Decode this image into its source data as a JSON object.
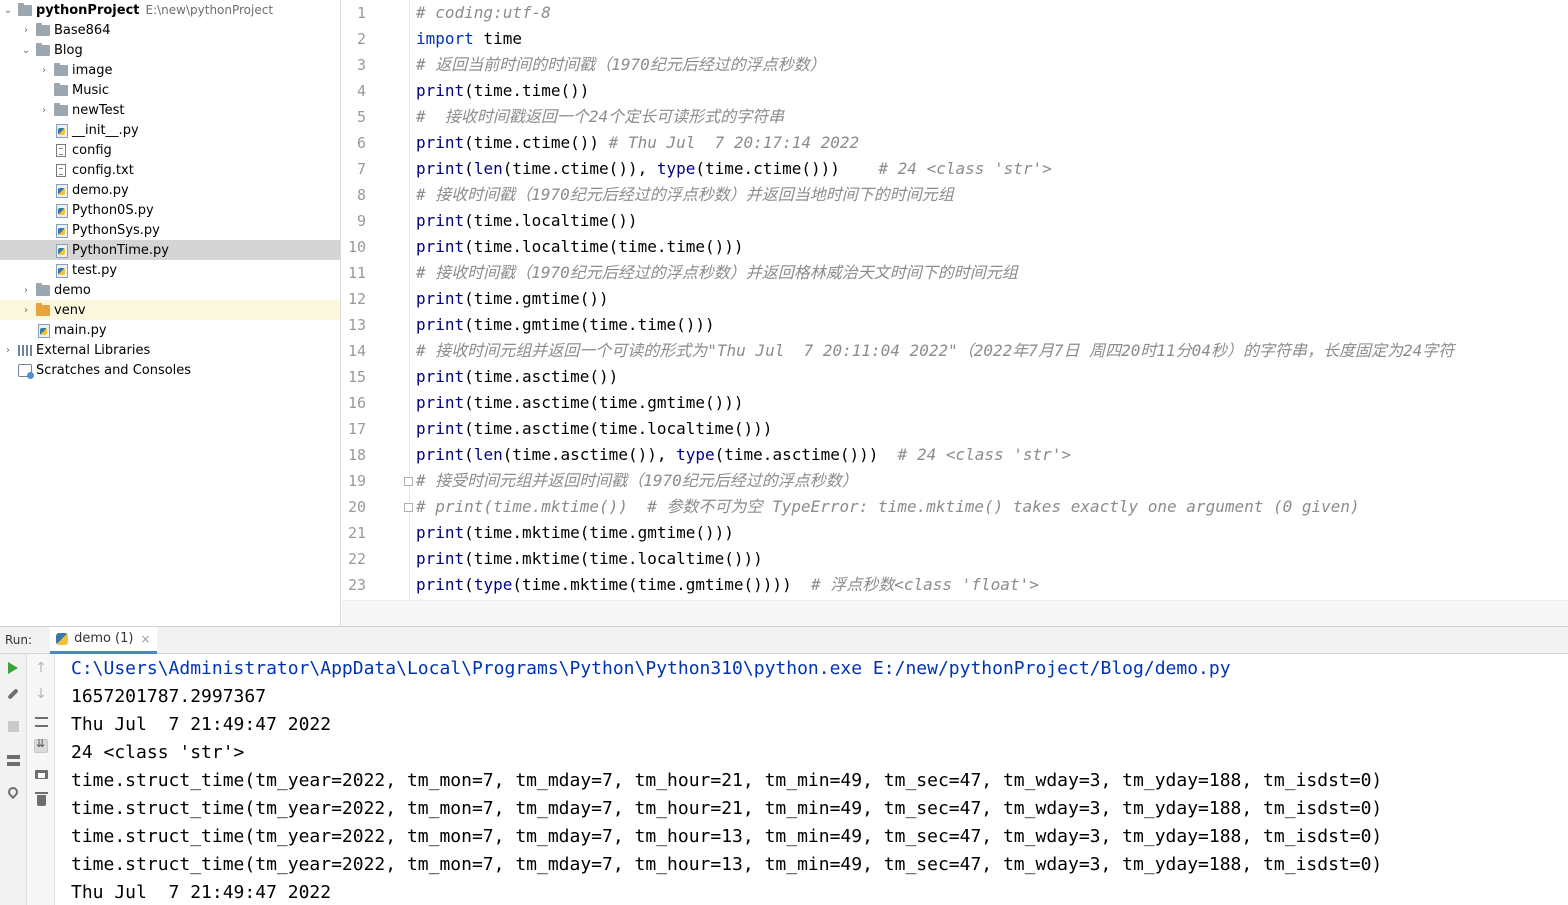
{
  "project_tree": {
    "root": {
      "name": "pythonProject",
      "path": "E:\\new\\pythonProject"
    },
    "items": [
      {
        "label": "Base864",
        "type": "folder",
        "depth": 1,
        "expandable": true,
        "expanded": false
      },
      {
        "label": "Blog",
        "type": "folder",
        "depth": 1,
        "expandable": true,
        "expanded": true
      },
      {
        "label": "image",
        "type": "folder",
        "depth": 2,
        "expandable": true,
        "expanded": false
      },
      {
        "label": "Music",
        "type": "folder",
        "depth": 2,
        "expandable": false
      },
      {
        "label": "newTest",
        "type": "folder",
        "depth": 2,
        "expandable": true,
        "expanded": false
      },
      {
        "label": "__init__.py",
        "type": "python-file",
        "depth": 2
      },
      {
        "label": "config",
        "type": "text-file",
        "depth": 2
      },
      {
        "label": "config.txt",
        "type": "text-file",
        "depth": 2
      },
      {
        "label": "demo.py",
        "type": "python-file",
        "depth": 2
      },
      {
        "label": "Python0S.py",
        "type": "python-file",
        "depth": 2
      },
      {
        "label": "PythonSys.py",
        "type": "python-file",
        "depth": 2
      },
      {
        "label": "PythonTime.py",
        "type": "python-file",
        "depth": 2,
        "selected": true
      },
      {
        "label": "test.py",
        "type": "python-file",
        "depth": 2
      },
      {
        "label": "demo",
        "type": "folder",
        "depth": 1,
        "expandable": true,
        "expanded": false
      },
      {
        "label": "venv",
        "type": "excluded-folder",
        "depth": 1,
        "expandable": true,
        "expanded": false
      },
      {
        "label": "main.py",
        "type": "python-file",
        "depth": 1
      }
    ],
    "external_libraries": "External Libraries",
    "scratches": "Scratches and Consoles"
  },
  "editor": {
    "lines": [
      {
        "n": "1",
        "comment": "# coding:utf-8"
      },
      {
        "n": "2",
        "tokens": [
          [
            "kw",
            "import"
          ],
          [
            "",
            " time"
          ]
        ]
      },
      {
        "n": "3",
        "comment": "# 返回当前时间的时间戳（1970纪元后经过的浮点秒数）"
      },
      {
        "n": "4",
        "tokens": [
          [
            "fn",
            "print"
          ],
          [
            "",
            "(time.time())"
          ]
        ]
      },
      {
        "n": "5",
        "comment": "#  接收时间戳返回一个24个定长可读形式的字符串"
      },
      {
        "n": "6",
        "tokens": [
          [
            "fn",
            "print"
          ],
          [
            "",
            "(time.ctime()) "
          ],
          [
            "cm",
            "# Thu Jul  7 20:17:14 2022"
          ]
        ]
      },
      {
        "n": "7",
        "tokens": [
          [
            "fn",
            "print"
          ],
          [
            "",
            "("
          ],
          [
            "fn",
            "len"
          ],
          [
            "",
            "(time.ctime()), "
          ],
          [
            "fn",
            "type"
          ],
          [
            "",
            "(time.ctime()))    "
          ],
          [
            "cm",
            "# 24 <class 'str'>"
          ]
        ]
      },
      {
        "n": "8",
        "comment": "# 接收时间戳（1970纪元后经过的浮点秒数）并返回当地时间下的时间元组"
      },
      {
        "n": "9",
        "tokens": [
          [
            "fn",
            "print"
          ],
          [
            "",
            "(time.localtime())"
          ]
        ]
      },
      {
        "n": "10",
        "tokens": [
          [
            "fn",
            "print"
          ],
          [
            "",
            "(time.localtime(time.time()))"
          ]
        ]
      },
      {
        "n": "11",
        "comment": "# 接收时间戳（1970纪元后经过的浮点秒数）并返回格林威治天文时间下的时间元组"
      },
      {
        "n": "12",
        "tokens": [
          [
            "fn",
            "print"
          ],
          [
            "",
            "(time.gmtime())"
          ]
        ]
      },
      {
        "n": "13",
        "tokens": [
          [
            "fn",
            "print"
          ],
          [
            "",
            "(time.gmtime(time.time()))"
          ]
        ]
      },
      {
        "n": "14",
        "comment": "# 接收时间元组并返回一个可读的形式为\"Thu Jul  7 20:11:04 2022\"（2022年7月7日 周四20时11分04秒）的字符串，长度固定为24字符"
      },
      {
        "n": "15",
        "tokens": [
          [
            "fn",
            "print"
          ],
          [
            "",
            "(time.asctime())"
          ]
        ]
      },
      {
        "n": "16",
        "tokens": [
          [
            "fn",
            "print"
          ],
          [
            "",
            "(time.asctime(time.gmtime()))"
          ]
        ]
      },
      {
        "n": "17",
        "tokens": [
          [
            "fn",
            "print"
          ],
          [
            "",
            "(time.asctime(time.localtime()))"
          ]
        ]
      },
      {
        "n": "18",
        "tokens": [
          [
            "fn",
            "print"
          ],
          [
            "",
            "("
          ],
          [
            "fn",
            "len"
          ],
          [
            "",
            "(time.asctime()), "
          ],
          [
            "fn",
            "type"
          ],
          [
            "",
            "(time.asctime()))  "
          ],
          [
            "cm",
            "# 24 <class 'str'>"
          ]
        ]
      },
      {
        "n": "19",
        "comment": "# 接受时间元组并返回时间戳（1970纪元后经过的浮点秒数）"
      },
      {
        "n": "20",
        "comment": "# print(time.mktime())  # 参数不可为空 TypeError: time.mktime() takes exactly one argument (0 given)"
      },
      {
        "n": "21",
        "tokens": [
          [
            "fn",
            "print"
          ],
          [
            "",
            "(time.mktime(time.gmtime()))"
          ]
        ]
      },
      {
        "n": "22",
        "tokens": [
          [
            "fn",
            "print"
          ],
          [
            "",
            "(time.mktime(time.localtime()))"
          ]
        ]
      },
      {
        "n": "23",
        "tokens": [
          [
            "fn",
            "print"
          ],
          [
            "",
            "("
          ],
          [
            "fn",
            "type"
          ],
          [
            "",
            "(time.mktime(time.gmtime())))  "
          ],
          [
            "cm",
            "# 浮点秒数<class 'float'>"
          ]
        ]
      }
    ]
  },
  "run_panel": {
    "label": "Run:",
    "tab_label": "demo (1)",
    "tab_close": "×",
    "output": [
      "C:\\Users\\Administrator\\AppData\\Local\\Programs\\Python\\Python310\\python.exe E:/new/pythonProject/Blog/demo.py",
      "1657201787.2997367",
      "Thu Jul  7 21:49:47 2022",
      "24 <class 'str'>",
      "time.struct_time(tm_year=2022, tm_mon=7, tm_mday=7, tm_hour=21, tm_min=49, tm_sec=47, tm_wday=3, tm_yday=188, tm_isdst=0)",
      "time.struct_time(tm_year=2022, tm_mon=7, tm_mday=7, tm_hour=21, tm_min=49, tm_sec=47, tm_wday=3, tm_yday=188, tm_isdst=0)",
      "time.struct_time(tm_year=2022, tm_mon=7, tm_mday=7, tm_hour=13, tm_min=49, tm_sec=47, tm_wday=3, tm_yday=188, tm_isdst=0)",
      "time.struct_time(tm_year=2022, tm_mon=7, tm_mday=7, tm_hour=13, tm_min=49, tm_sec=47, tm_wday=3, tm_yday=188, tm_isdst=0)",
      "Thu Jul  7 21:49:47 2022"
    ]
  },
  "colors": {
    "keyword": "#0033b3",
    "builtin": "#000080",
    "comment": "#8c8c8c",
    "selection": "#d5d5d5",
    "run_play": "#3ba23b"
  }
}
